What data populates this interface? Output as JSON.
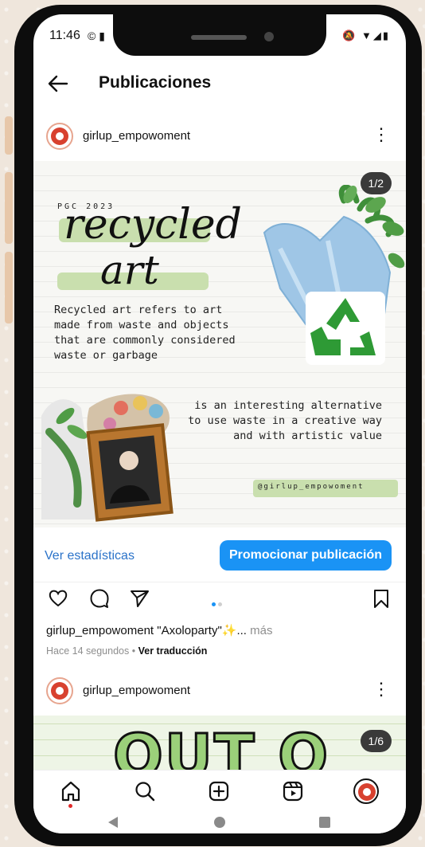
{
  "status": {
    "time": "11:46",
    "left_icons": "© ▮",
    "right_icons": "🔕 ▼◢▮"
  },
  "appbar": {
    "title": "Publicaciones"
  },
  "post1": {
    "username": "girlup_empowoment",
    "counter": "1/2",
    "image": {
      "tag": "PGC 2023",
      "title_line1": "recycled",
      "title_line2": "art",
      "description": "Recycled art refers to art made from waste and objects that are commonly considered waste or garbage",
      "description2": "is an interesting alternative to use waste in a creative way and with artistic value",
      "handle": "@girlup_empowoment"
    },
    "stats_link": "Ver estadísticas",
    "promote_button": "Promocionar publicación",
    "caption_user": "girlup_empowoment",
    "caption_text": "\"Axoloparty\"✨...",
    "caption_more": "más",
    "time_ago": "Hace 14 segundos",
    "separator": "•",
    "translate": "Ver traducción"
  },
  "post2": {
    "username": "girlup_empowoment",
    "counter": "1/6",
    "image_text": "OUT O"
  },
  "colors": {
    "accent": "#1a93f5",
    "link": "#2b73c9",
    "highlight": "#c9dfae"
  },
  "icons": [
    "back-arrow-icon",
    "more-icon",
    "heart-icon",
    "comment-icon",
    "share-icon",
    "bookmark-icon",
    "home-icon",
    "search-icon",
    "create-icon",
    "reels-icon",
    "profile-icon"
  ]
}
